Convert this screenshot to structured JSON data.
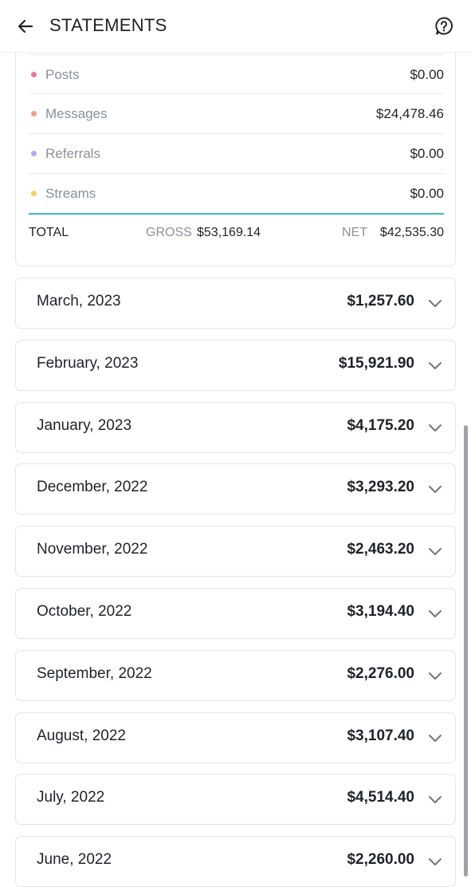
{
  "header": {
    "title": "STATEMENTS",
    "back_icon": "arrow-left-icon",
    "help_icon": "help-circle-icon"
  },
  "summary": {
    "rows": [
      {
        "label": "Posts",
        "value": "$0.00",
        "dot_color": "#e77b9a"
      },
      {
        "label": "Messages",
        "value": "$24,478.46",
        "dot_color": "#f2a08a"
      },
      {
        "label": "Referrals",
        "value": "$0.00",
        "dot_color": "#b8a8e6"
      },
      {
        "label": "Streams",
        "value": "$0.00",
        "dot_color": "#f3cf6b"
      }
    ],
    "total_label": "TOTAL",
    "gross_label": "GROSS",
    "gross_value": "$53,169.14",
    "net_label": "NET",
    "net_value": "$42,535.30",
    "accent_color": "#3fb8cf"
  },
  "months": [
    {
      "label": "March, 2023",
      "amount": "$1,257.60"
    },
    {
      "label": "February, 2023",
      "amount": "$15,921.90"
    },
    {
      "label": "January, 2023",
      "amount": "$4,175.20"
    },
    {
      "label": "December, 2022",
      "amount": "$3,293.20"
    },
    {
      "label": "November, 2022",
      "amount": "$2,463.20"
    },
    {
      "label": "October, 2022",
      "amount": "$3,194.40"
    },
    {
      "label": "September, 2022",
      "amount": "$2,276.00"
    },
    {
      "label": "August, 2022",
      "amount": "$3,107.40"
    },
    {
      "label": "July, 2022",
      "amount": "$4,514.40"
    },
    {
      "label": "June, 2022",
      "amount": "$2,260.00"
    }
  ],
  "month_expand_icon": "chevron-down-icon"
}
